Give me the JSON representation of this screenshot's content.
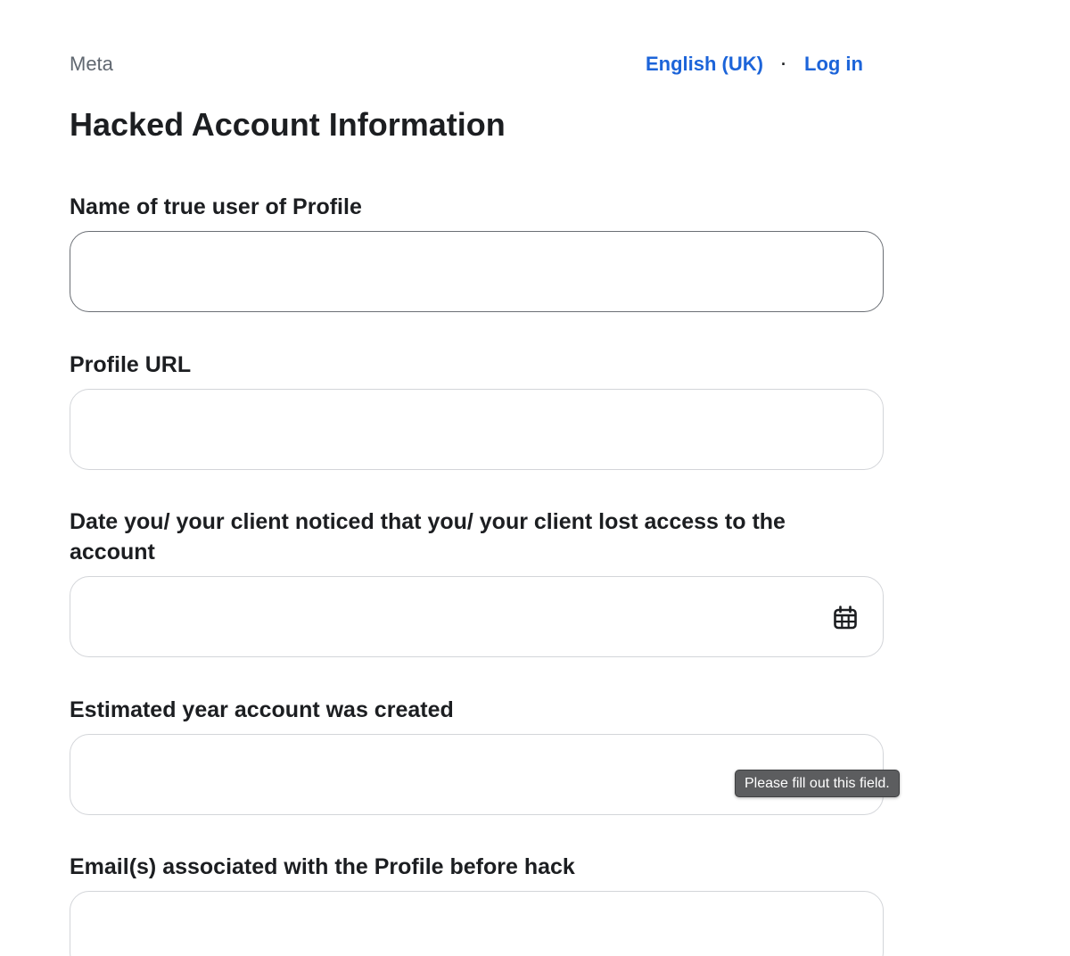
{
  "header": {
    "brand": "Meta",
    "language_link": "English (UK)",
    "separator": "·",
    "login_link": "Log in"
  },
  "page_title": "Hacked Account Information",
  "form": {
    "fields": [
      {
        "label": "Name of true user of Profile",
        "value": "",
        "state": "focused"
      },
      {
        "label": "Profile URL",
        "value": ""
      },
      {
        "label": "Date you/ your client noticed that you/ your client lost access to the account",
        "value": "",
        "icon": "calendar-icon"
      },
      {
        "label": "Estimated year account was created",
        "value": ""
      },
      {
        "label": "Email(s) associated with the Profile before hack",
        "value": ""
      }
    ]
  },
  "validation_tooltip": "Please fill out this field.",
  "colors": {
    "link": "#1c64d9",
    "text": "#1c1e21",
    "muted": "#606770",
    "border": "#d3d5d9",
    "focused_border": "#6b6f75",
    "tooltip_bg": "#5c5d5f"
  }
}
